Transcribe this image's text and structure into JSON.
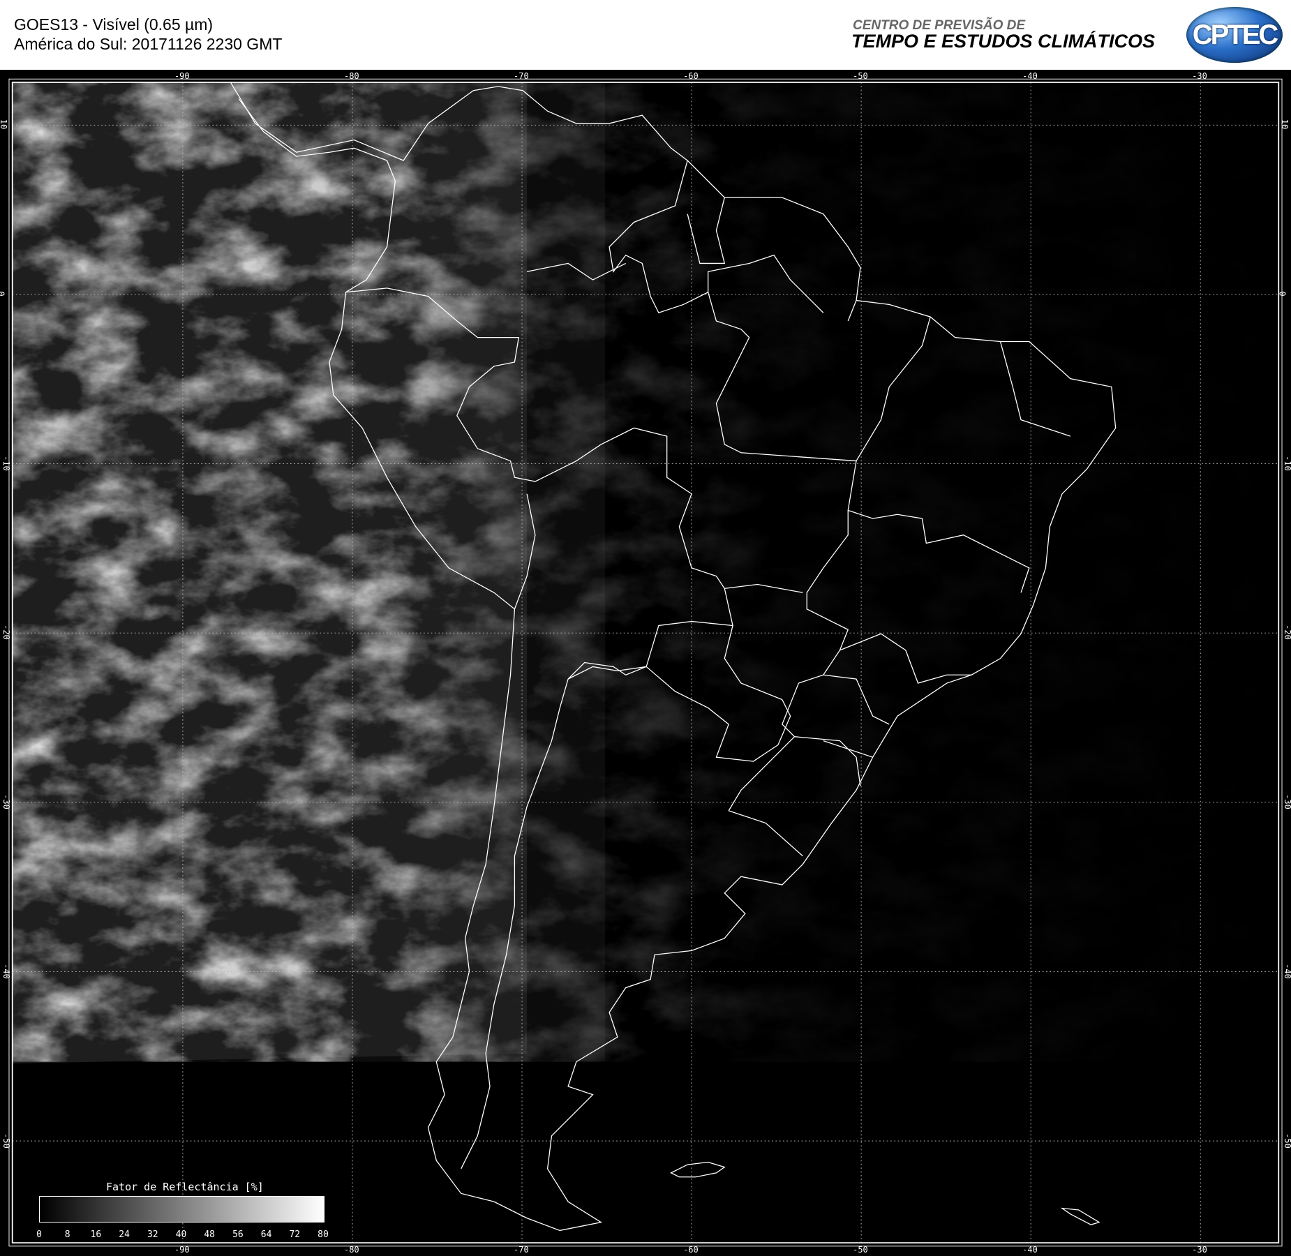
{
  "header": {
    "title": "GOES13 - Visível (0.65 µm)",
    "subtitle": "América do Sul: 20171126 2230 GMT",
    "org_line1": "CENTRO DE PREVISÃO DE",
    "org_line2": "TEMPO E ESTUDOS CLIMÁTICOS",
    "logo_text": "CPTEC"
  },
  "map": {
    "longitude_labels": [
      "-90",
      "-80",
      "-70",
      "-60",
      "-50",
      "-40",
      "-30"
    ],
    "latitude_labels": [
      "10",
      "0",
      "-10",
      "-20",
      "-30",
      "-40",
      "-50"
    ]
  },
  "legend": {
    "title": "Fator de Reflectância [%]",
    "labels": [
      "0",
      "8",
      "16",
      "24",
      "32",
      "40",
      "48",
      "56",
      "64",
      "72",
      "80"
    ]
  }
}
